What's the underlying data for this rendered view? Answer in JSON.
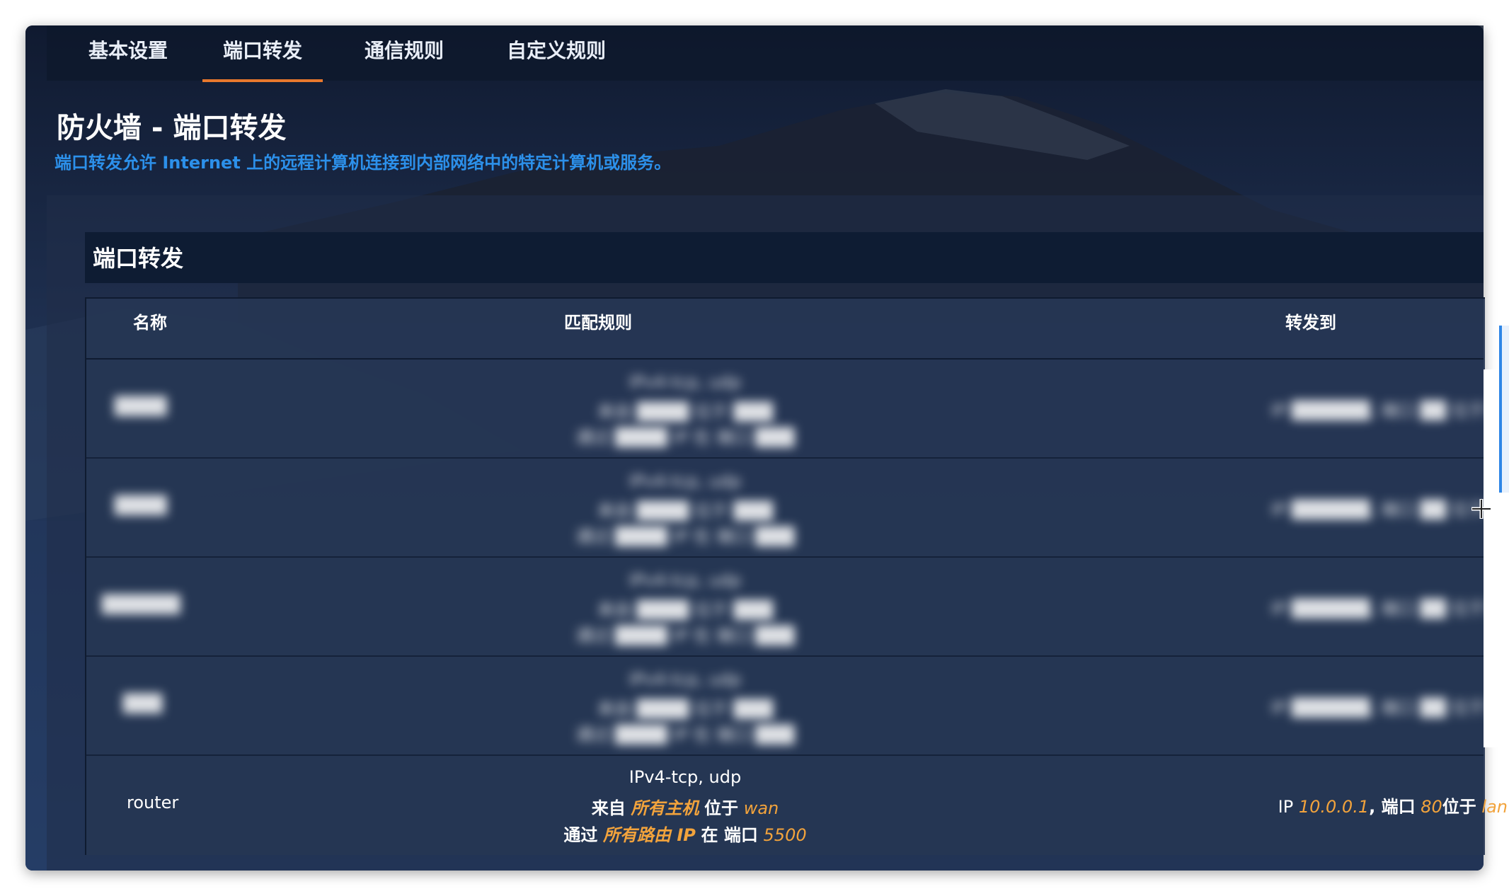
{
  "tabs": [
    {
      "label": "基本设置"
    },
    {
      "label": "端口转发"
    },
    {
      "label": "通信规则"
    },
    {
      "label": "自定义规则"
    }
  ],
  "page": {
    "title": "防火墙 - 端口转发",
    "description": "端口转发允许 Internet 上的远程计算机连接到内部网络中的特定计算机或服务。"
  },
  "section": {
    "title": "端口转发"
  },
  "table": {
    "headers": {
      "name": "名称",
      "match": "匹配规则",
      "forward": "转发到"
    },
    "blurred_rows": [
      {
        "name": "████",
        "proto": "IPv4-tcp, udp",
        "from": "来自 ████ 位于 ███",
        "via": "通过 ████ IP 在 端口 ███",
        "to": "IP ██████, 端口 ██ 位于 ███"
      },
      {
        "name": "████",
        "proto": "IPv4-tcp, udp",
        "from": "来自 ████ 位于 ███",
        "via": "通过 ████ IP 在 端口 ███",
        "to": "IP ██████, 端口 ██ 位于 ███"
      },
      {
        "name": "██████",
        "proto": "IPv4-tcp, udp",
        "from": "来自 ████ 位于 ███",
        "via": "通过 ████ IP 在 端口 ███",
        "to": "IP ██████, 端口 ██ 位于 ███"
      },
      {
        "name": "███",
        "proto": "IPv4-tcp, udp",
        "from": "来自 ████ 位于 ███",
        "via": "通过 ████ IP 在 端口 ███",
        "to": "IP ██████, 端口 ██ 位于 ███"
      }
    ],
    "visible_row": {
      "name": "router",
      "proto": "IPv4-tcp, udp",
      "from_prefix": "来自",
      "from_host": "所有主机",
      "from_mid": "位于",
      "from_zone": "wan",
      "via_prefix": "通过",
      "via_ip": "所有路由 IP",
      "via_mid": "在 端口",
      "via_port": "5500",
      "to_ip_label": "IP",
      "to_ip": "10.0.0.1",
      "to_port_label": ", 端口",
      "to_port": "80",
      "to_zone_label": "位于",
      "to_zone": "lan"
    }
  },
  "colors": {
    "accent_tab": "#e8782d",
    "desc_text": "#2c90ea",
    "highlight": "#f2a33c"
  }
}
